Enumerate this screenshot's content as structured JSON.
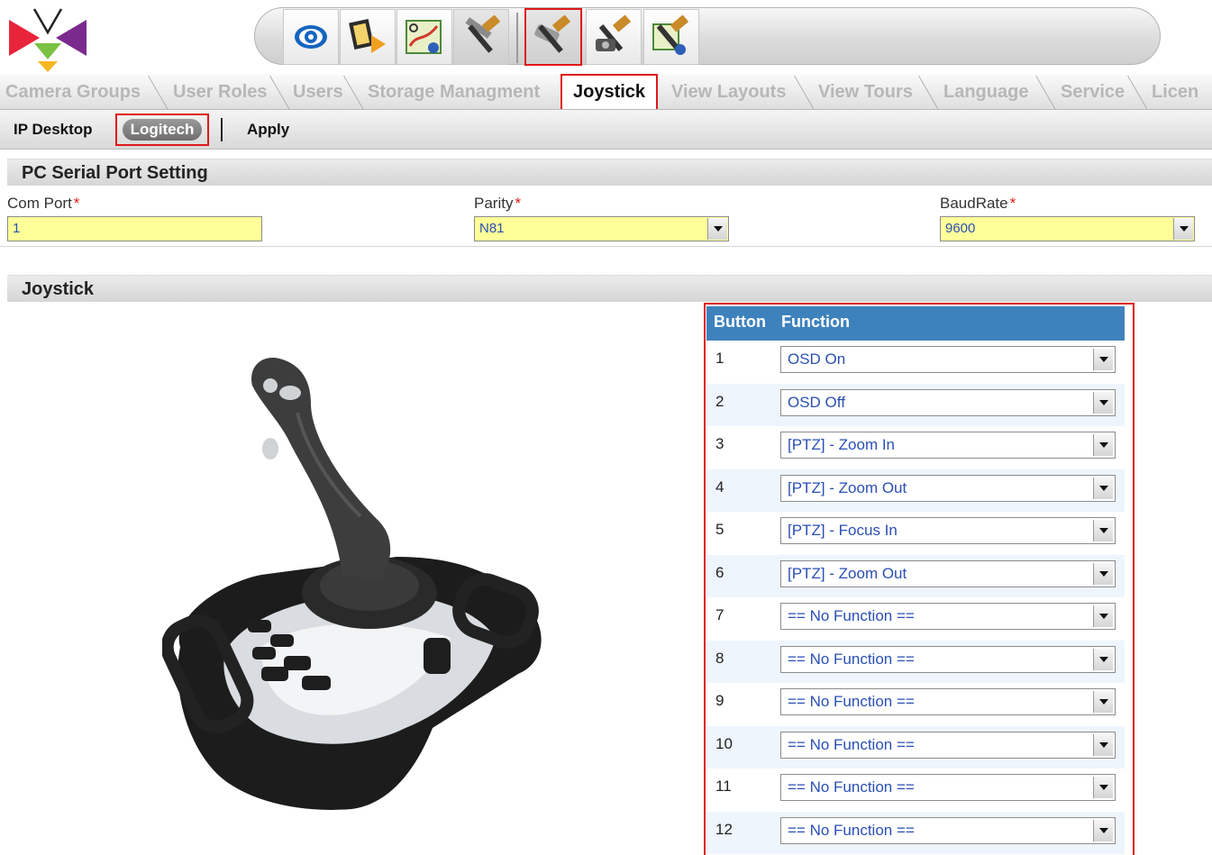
{
  "toolbar": {
    "buttons": [
      {
        "icon": "eye-icon"
      },
      {
        "icon": "film-arrow-icon"
      },
      {
        "icon": "map-tools-icon"
      },
      {
        "icon": "tools-icon"
      },
      {
        "icon": "camera-tools-icon"
      },
      {
        "icon": "tools-camera-icon"
      },
      {
        "icon": "map-tools-badge-icon"
      }
    ]
  },
  "tabs": [
    {
      "label": "Camera Groups"
    },
    {
      "label": "User Roles"
    },
    {
      "label": "Users"
    },
    {
      "label": "Storage Managment"
    },
    {
      "label": "Joystick",
      "active": true
    },
    {
      "label": "View Layouts"
    },
    {
      "label": "View Tours"
    },
    {
      "label": "Language"
    },
    {
      "label": "Service"
    },
    {
      "label": "Licen"
    }
  ],
  "subnav": {
    "ip_desktop": "IP Desktop",
    "logitech": "Logitech",
    "apply": "Apply"
  },
  "serial": {
    "title": "PC Serial Port Setting",
    "com_port": {
      "label": "Com Port",
      "required": "*",
      "value": "1"
    },
    "parity": {
      "label": "Parity",
      "required": "*",
      "value": "N81"
    },
    "baudrate": {
      "label": "BaudRate",
      "required": "*",
      "value": "9600"
    }
  },
  "joystick": {
    "title": "Joystick",
    "table": {
      "col_button": "Button",
      "col_function": "Function",
      "rows": [
        {
          "button": "1",
          "function": "OSD On"
        },
        {
          "button": "2",
          "function": "OSD Off"
        },
        {
          "button": "3",
          "function": "[PTZ] - Zoom In"
        },
        {
          "button": "4",
          "function": "[PTZ] - Zoom Out"
        },
        {
          "button": "5",
          "function": "[PTZ] - Focus In"
        },
        {
          "button": "6",
          "function": "[PTZ] - Zoom Out"
        },
        {
          "button": "7",
          "function": "== No Function =="
        },
        {
          "button": "8",
          "function": "== No Function =="
        },
        {
          "button": "9",
          "function": "== No Function =="
        },
        {
          "button": "10",
          "function": "== No Function =="
        },
        {
          "button": "11",
          "function": "== No Function =="
        },
        {
          "button": "12",
          "function": "== No Function =="
        }
      ]
    }
  },
  "colors": {
    "accent_red": "#e01818",
    "header_blue": "#3e82bd",
    "field_yellow": "#ffff99",
    "value_blue": "#2a4fb5"
  }
}
